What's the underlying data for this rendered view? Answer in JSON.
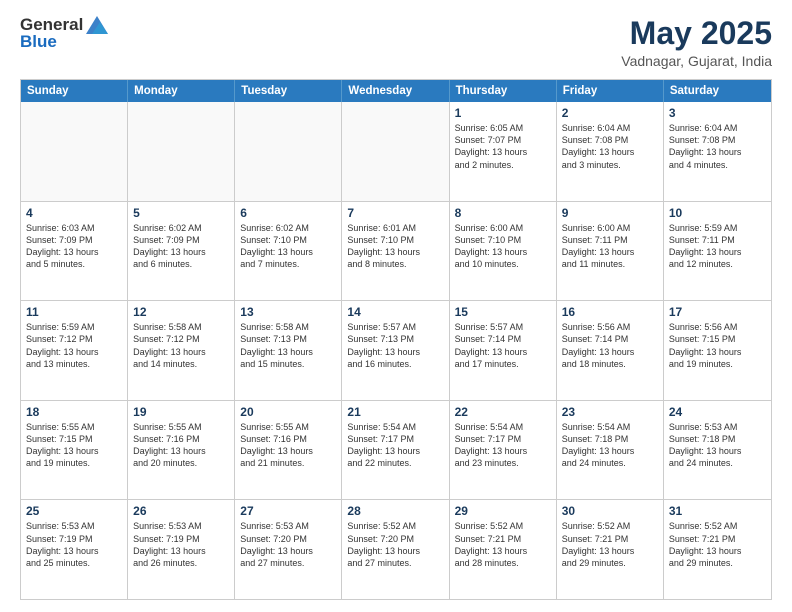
{
  "header": {
    "logo_general": "General",
    "logo_blue": "Blue",
    "month_title": "May 2025",
    "location": "Vadnagar, Gujarat, India"
  },
  "calendar": {
    "days_of_week": [
      "Sunday",
      "Monday",
      "Tuesday",
      "Wednesday",
      "Thursday",
      "Friday",
      "Saturday"
    ],
    "weeks": [
      [
        {
          "day": "",
          "text": "",
          "empty": true
        },
        {
          "day": "",
          "text": "",
          "empty": true
        },
        {
          "day": "",
          "text": "",
          "empty": true
        },
        {
          "day": "",
          "text": "",
          "empty": true
        },
        {
          "day": "1",
          "text": "Sunrise: 6:05 AM\nSunset: 7:07 PM\nDaylight: 13 hours\nand 2 minutes.",
          "empty": false
        },
        {
          "day": "2",
          "text": "Sunrise: 6:04 AM\nSunset: 7:08 PM\nDaylight: 13 hours\nand 3 minutes.",
          "empty": false
        },
        {
          "day": "3",
          "text": "Sunrise: 6:04 AM\nSunset: 7:08 PM\nDaylight: 13 hours\nand 4 minutes.",
          "empty": false
        }
      ],
      [
        {
          "day": "4",
          "text": "Sunrise: 6:03 AM\nSunset: 7:09 PM\nDaylight: 13 hours\nand 5 minutes.",
          "empty": false
        },
        {
          "day": "5",
          "text": "Sunrise: 6:02 AM\nSunset: 7:09 PM\nDaylight: 13 hours\nand 6 minutes.",
          "empty": false
        },
        {
          "day": "6",
          "text": "Sunrise: 6:02 AM\nSunset: 7:10 PM\nDaylight: 13 hours\nand 7 minutes.",
          "empty": false
        },
        {
          "day": "7",
          "text": "Sunrise: 6:01 AM\nSunset: 7:10 PM\nDaylight: 13 hours\nand 8 minutes.",
          "empty": false
        },
        {
          "day": "8",
          "text": "Sunrise: 6:00 AM\nSunset: 7:10 PM\nDaylight: 13 hours\nand 10 minutes.",
          "empty": false
        },
        {
          "day": "9",
          "text": "Sunrise: 6:00 AM\nSunset: 7:11 PM\nDaylight: 13 hours\nand 11 minutes.",
          "empty": false
        },
        {
          "day": "10",
          "text": "Sunrise: 5:59 AM\nSunset: 7:11 PM\nDaylight: 13 hours\nand 12 minutes.",
          "empty": false
        }
      ],
      [
        {
          "day": "11",
          "text": "Sunrise: 5:59 AM\nSunset: 7:12 PM\nDaylight: 13 hours\nand 13 minutes.",
          "empty": false
        },
        {
          "day": "12",
          "text": "Sunrise: 5:58 AM\nSunset: 7:12 PM\nDaylight: 13 hours\nand 14 minutes.",
          "empty": false
        },
        {
          "day": "13",
          "text": "Sunrise: 5:58 AM\nSunset: 7:13 PM\nDaylight: 13 hours\nand 15 minutes.",
          "empty": false
        },
        {
          "day": "14",
          "text": "Sunrise: 5:57 AM\nSunset: 7:13 PM\nDaylight: 13 hours\nand 16 minutes.",
          "empty": false
        },
        {
          "day": "15",
          "text": "Sunrise: 5:57 AM\nSunset: 7:14 PM\nDaylight: 13 hours\nand 17 minutes.",
          "empty": false
        },
        {
          "day": "16",
          "text": "Sunrise: 5:56 AM\nSunset: 7:14 PM\nDaylight: 13 hours\nand 18 minutes.",
          "empty": false
        },
        {
          "day": "17",
          "text": "Sunrise: 5:56 AM\nSunset: 7:15 PM\nDaylight: 13 hours\nand 19 minutes.",
          "empty": false
        }
      ],
      [
        {
          "day": "18",
          "text": "Sunrise: 5:55 AM\nSunset: 7:15 PM\nDaylight: 13 hours\nand 19 minutes.",
          "empty": false
        },
        {
          "day": "19",
          "text": "Sunrise: 5:55 AM\nSunset: 7:16 PM\nDaylight: 13 hours\nand 20 minutes.",
          "empty": false
        },
        {
          "day": "20",
          "text": "Sunrise: 5:55 AM\nSunset: 7:16 PM\nDaylight: 13 hours\nand 21 minutes.",
          "empty": false
        },
        {
          "day": "21",
          "text": "Sunrise: 5:54 AM\nSunset: 7:17 PM\nDaylight: 13 hours\nand 22 minutes.",
          "empty": false
        },
        {
          "day": "22",
          "text": "Sunrise: 5:54 AM\nSunset: 7:17 PM\nDaylight: 13 hours\nand 23 minutes.",
          "empty": false
        },
        {
          "day": "23",
          "text": "Sunrise: 5:54 AM\nSunset: 7:18 PM\nDaylight: 13 hours\nand 24 minutes.",
          "empty": false
        },
        {
          "day": "24",
          "text": "Sunrise: 5:53 AM\nSunset: 7:18 PM\nDaylight: 13 hours\nand 24 minutes.",
          "empty": false
        }
      ],
      [
        {
          "day": "25",
          "text": "Sunrise: 5:53 AM\nSunset: 7:19 PM\nDaylight: 13 hours\nand 25 minutes.",
          "empty": false
        },
        {
          "day": "26",
          "text": "Sunrise: 5:53 AM\nSunset: 7:19 PM\nDaylight: 13 hours\nand 26 minutes.",
          "empty": false
        },
        {
          "day": "27",
          "text": "Sunrise: 5:53 AM\nSunset: 7:20 PM\nDaylight: 13 hours\nand 27 minutes.",
          "empty": false
        },
        {
          "day": "28",
          "text": "Sunrise: 5:52 AM\nSunset: 7:20 PM\nDaylight: 13 hours\nand 27 minutes.",
          "empty": false
        },
        {
          "day": "29",
          "text": "Sunrise: 5:52 AM\nSunset: 7:21 PM\nDaylight: 13 hours\nand 28 minutes.",
          "empty": false
        },
        {
          "day": "30",
          "text": "Sunrise: 5:52 AM\nSunset: 7:21 PM\nDaylight: 13 hours\nand 29 minutes.",
          "empty": false
        },
        {
          "day": "31",
          "text": "Sunrise: 5:52 AM\nSunset: 7:21 PM\nDaylight: 13 hours\nand 29 minutes.",
          "empty": false
        }
      ]
    ]
  }
}
